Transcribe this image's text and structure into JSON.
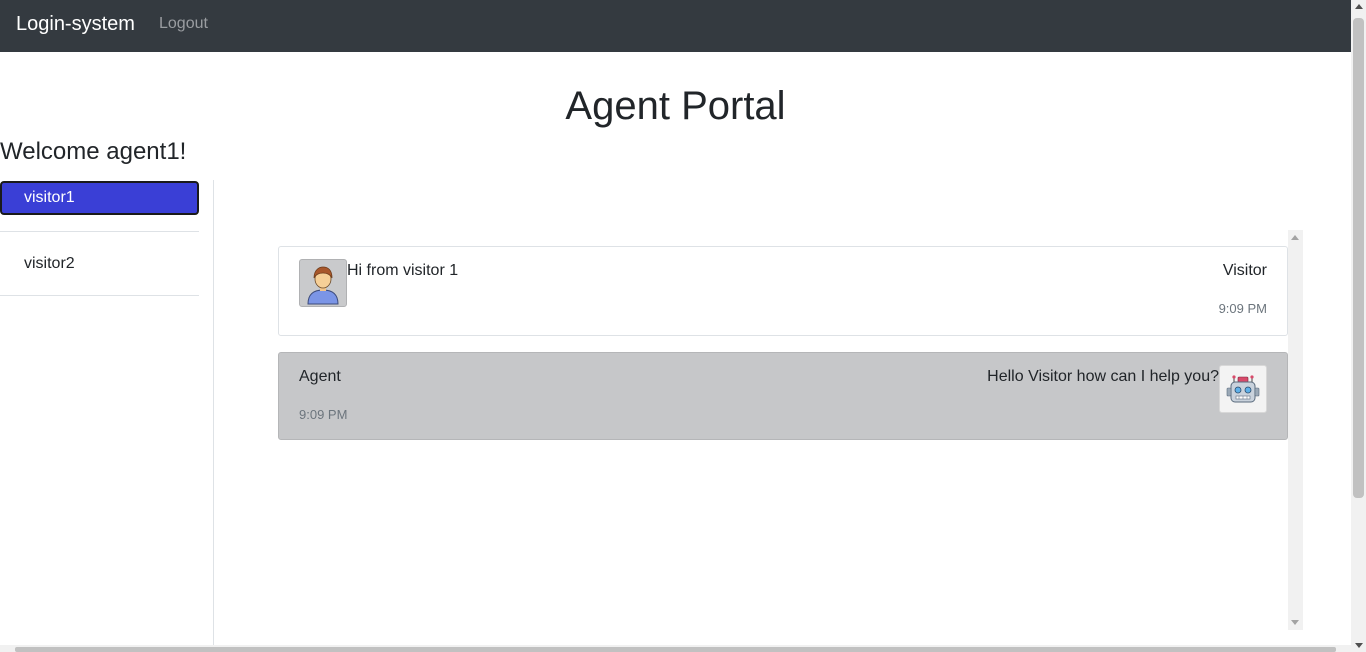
{
  "navbar": {
    "brand": "Login-system",
    "logout_label": "Logout"
  },
  "page": {
    "title": "Agent Portal",
    "welcome": "Welcome agent1!"
  },
  "sidebar": {
    "items": [
      {
        "label": "visitor1",
        "active": true
      },
      {
        "label": "visitor2",
        "active": false
      }
    ],
    "active_color": "#3a3fd6"
  },
  "chat": {
    "messages": [
      {
        "sender": "Visitor",
        "text": "Hi from visitor 1",
        "time": "9:09 PM",
        "avatar_icon": "user-avatar-icon"
      },
      {
        "sender": "Agent",
        "text": "Hello Visitor how can I help you?",
        "time": "9:09 PM",
        "avatar_icon": "robot-avatar-icon",
        "background": "#c6c7c9"
      }
    ]
  }
}
